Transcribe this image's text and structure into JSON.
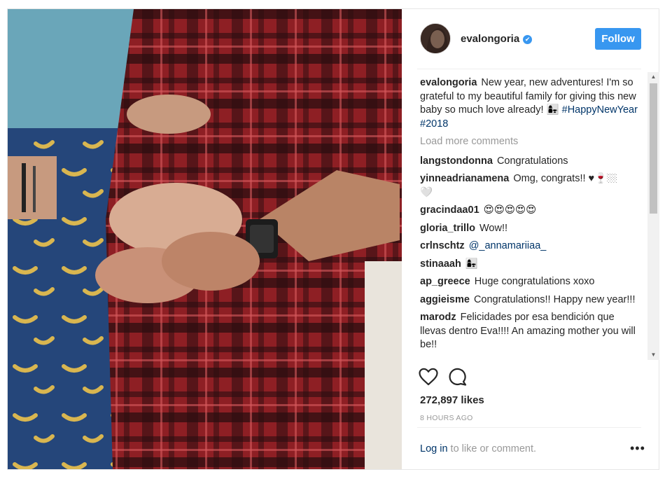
{
  "header": {
    "username": "evalongoria",
    "verified_icon": "✔",
    "follow_label": "Follow"
  },
  "caption": {
    "username": "evalongoria",
    "text": "New year, new adventures! I'm so grateful to my beautiful family for giving this new baby so much love already! 👩‍👧",
    "hashtags": "#HappyNewYear #2018"
  },
  "load_more": "Load more comments",
  "comments": [
    {
      "user": "langstondonna",
      "text": "Congratulations"
    },
    {
      "user": "yinneadrianamena",
      "text": "Omg, congrats!! ♥🍷🏼\n🤍"
    },
    {
      "user": "gracindaa01",
      "text": "😍😍😍😍😍"
    },
    {
      "user": "gloria_trillo",
      "text": "Wow!!"
    },
    {
      "user": "crlnschtz",
      "text": "@_annamariiaa_"
    },
    {
      "user": "stinaaah",
      "text": "👩‍👧"
    },
    {
      "user": "ap_greece",
      "text": "Huge congratulations xoxo"
    },
    {
      "user": "aggieisme",
      "text": "Congratulations!! Happy new year!!!"
    },
    {
      "user": "marodz",
      "text": "Felicidades por esa bendición que llevas dentro Eva!!!! An amazing mother you will be!!"
    }
  ],
  "likes": "272,897 likes",
  "time": "8 HOURS AGO",
  "login": {
    "link": "Log in",
    "rest": " to like or comment."
  },
  "more_label": "•••",
  "colors": {
    "accent": "#3897f0",
    "link": "#003569",
    "muted": "#999999"
  }
}
